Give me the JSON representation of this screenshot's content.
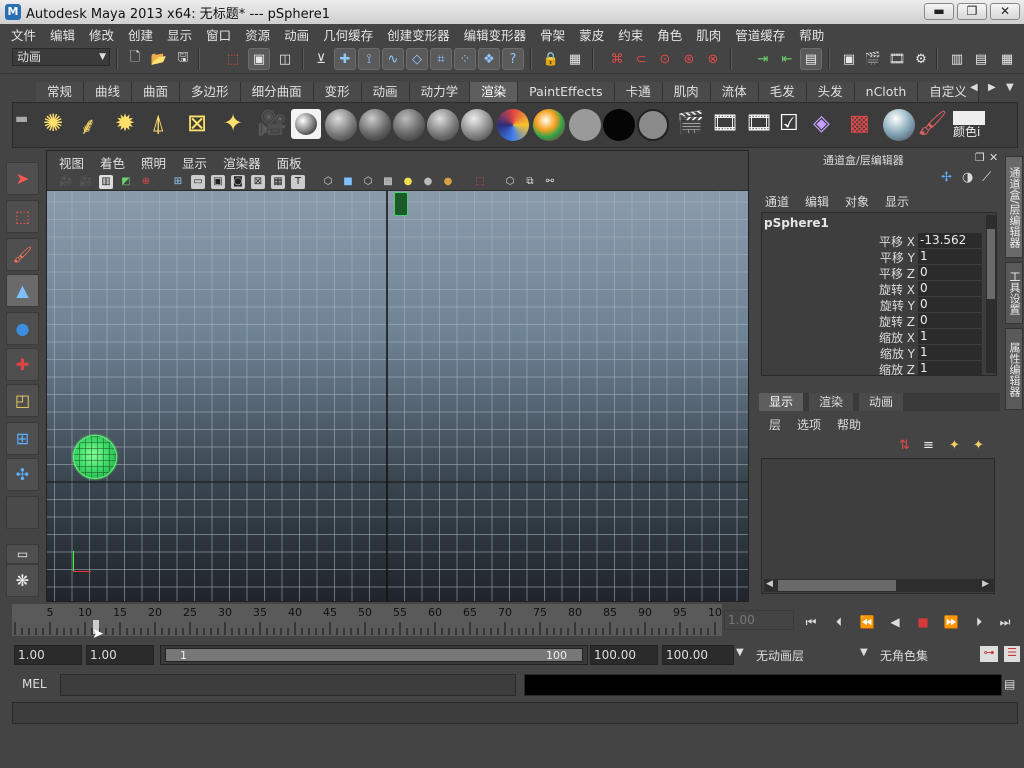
{
  "window": {
    "title": "Autodesk Maya 2013 x64: 无标题*   ---   pSphere1",
    "minimize": "▬",
    "restore": "❐",
    "close": "✕"
  },
  "menubar": [
    "文件",
    "编辑",
    "修改",
    "创建",
    "显示",
    "窗口",
    "资源",
    "动画",
    "几何缓存",
    "创建变形器",
    "编辑变形器",
    "骨架",
    "蒙皮",
    "约束",
    "角色",
    "肌肉",
    "管道缓存",
    "帮助"
  ],
  "statusline": {
    "menuset": "动画"
  },
  "shelf": {
    "tabs": [
      "常规",
      "曲线",
      "曲面",
      "多边形",
      "细分曲面",
      "变形",
      "动画",
      "动力学",
      "渲染",
      "PaintEffects",
      "卡通",
      "肌肉",
      "流体",
      "毛发",
      "头发",
      "nCloth",
      "自定义"
    ],
    "active_tab": "渲染",
    "color_label": "颜色i"
  },
  "panel": {
    "menu": [
      "视图",
      "着色",
      "照明",
      "显示",
      "渲染器",
      "面板"
    ]
  },
  "channelbox": {
    "header": "通道盒/层编辑器",
    "menu": [
      "通道",
      "编辑",
      "对象",
      "显示"
    ],
    "object": "pSphere1",
    "attributes": [
      {
        "label": "平移 X",
        "value": "-13.562"
      },
      {
        "label": "平移 Y",
        "value": "1"
      },
      {
        "label": "平移 Z",
        "value": "0"
      },
      {
        "label": "旋转 X",
        "value": "0"
      },
      {
        "label": "旋转 Y",
        "value": "0"
      },
      {
        "label": "旋转 Z",
        "value": "0"
      },
      {
        "label": "缩放 X",
        "value": "1"
      },
      {
        "label": "缩放 Y",
        "value": "1"
      },
      {
        "label": "缩放 Z",
        "value": "1"
      }
    ]
  },
  "layereditor": {
    "tabs": [
      "显示",
      "渲染",
      "动画"
    ],
    "active_tab": "显示",
    "menu": [
      "层",
      "选项",
      "帮助"
    ]
  },
  "vtabs": [
    "通道盒/层编辑器",
    "工具设置",
    "属性编辑器"
  ],
  "timeslider": {
    "ticks": [
      "5",
      "10",
      "15",
      "20",
      "25",
      "30",
      "35",
      "40",
      "45",
      "50",
      "55",
      "60",
      "65",
      "70",
      "75",
      "80",
      "85",
      "90",
      "95",
      "10"
    ],
    "current_frame": "1.00"
  },
  "range": {
    "start": "1.00",
    "anim_start": "1.00",
    "slider_left": "1",
    "slider_right": "100",
    "anim_end": "100.00",
    "end": "100.00",
    "anim_layer": "无动画层",
    "char_set": "无角色集"
  },
  "cmdline": {
    "label": "MEL"
  },
  "colors": {
    "accent": "#5e5e5e",
    "sphere": "#3fdc6a",
    "record": "#d43a3a"
  }
}
